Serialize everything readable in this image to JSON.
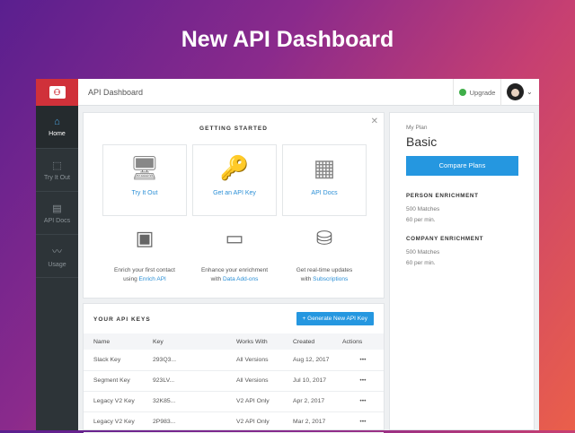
{
  "headline": "New API Dashboard",
  "topbar": {
    "title": "API Dashboard",
    "upgrade": "Upgrade"
  },
  "sidebar": {
    "items": [
      {
        "label": "Home",
        "icon": "home-icon",
        "active": true
      },
      {
        "label": "Try It Out",
        "icon": "cursor-icon"
      },
      {
        "label": "API Docs",
        "icon": "doc-icon"
      },
      {
        "label": "Usage",
        "icon": "chart-icon"
      }
    ]
  },
  "getting_started": {
    "title": "GETTING STARTED",
    "tiles": [
      {
        "label": "Try It Out"
      },
      {
        "label": "Get an API Key"
      },
      {
        "label": "API Docs"
      }
    ],
    "features": [
      {
        "text": "Enrich your first contact",
        "prefix": "using",
        "link": "Enrich API"
      },
      {
        "text": "Enhance your enrichment",
        "prefix": "with",
        "link": "Data Add-ons"
      },
      {
        "text": "Get real-time updates",
        "prefix": "with",
        "link": "Subscriptions"
      }
    ]
  },
  "api_keys": {
    "title": "YOUR API KEYS",
    "generate": "+ Generate New API Key",
    "columns": [
      "Name",
      "Key",
      "Works With",
      "Created",
      "Actions"
    ],
    "rows": [
      [
        "Slack Key",
        "293Q3...",
        "All Versions",
        "Aug 12, 2017",
        "•••"
      ],
      [
        "Segment Key",
        "923LV...",
        "All Versions",
        "Jul 10, 2017",
        "•••"
      ],
      [
        "Legacy V2 Key",
        "32K85...",
        "V2 API Only",
        "Apr 2, 2017",
        "•••"
      ],
      [
        "Legacy V2 Key",
        "2P983...",
        "V2 API Only",
        "Mar 2, 2017",
        "•••"
      ]
    ]
  },
  "plan": {
    "label": "My Plan",
    "name": "Basic",
    "button": "Compare Plans",
    "sections": [
      {
        "title": "PERSON ENRICHMENT",
        "lines": [
          "500 Matches",
          "60 per min."
        ]
      },
      {
        "title": "COMPANY ENRICHMENT",
        "lines": [
          "500 Matches",
          "60 per min."
        ]
      }
    ]
  }
}
